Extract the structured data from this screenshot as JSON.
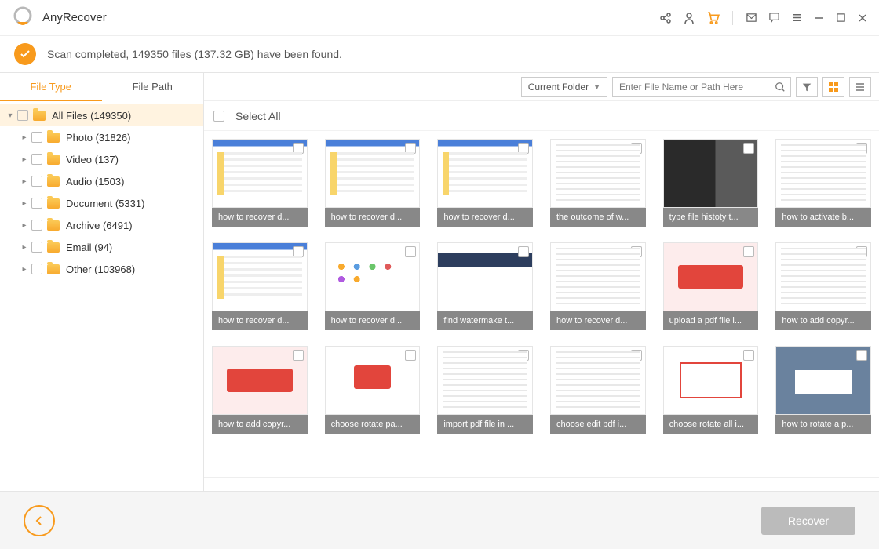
{
  "app": {
    "title": "AnyRecover"
  },
  "status": {
    "text": "Scan completed, 149350 files (137.32 GB) have been found."
  },
  "sidebar": {
    "tabs": [
      {
        "label": "File Type",
        "active": true
      },
      {
        "label": "File Path",
        "active": false
      }
    ],
    "root": {
      "label": "All Files (149350)"
    },
    "items": [
      {
        "label": "Photo (31826)"
      },
      {
        "label": "Video (137)"
      },
      {
        "label": "Audio (1503)"
      },
      {
        "label": "Document (5331)"
      },
      {
        "label": "Archive (6491)"
      },
      {
        "label": "Email (94)"
      },
      {
        "label": "Other (103968)"
      }
    ]
  },
  "toolbar": {
    "folder_dropdown": "Current Folder",
    "search_placeholder": "Enter File Name or Path Here"
  },
  "select_all": {
    "label": "Select All"
  },
  "thumbnails": [
    {
      "caption": "how to recover d...",
      "variant": "timg-win"
    },
    {
      "caption": "how to recover d...",
      "variant": "timg-win"
    },
    {
      "caption": "how to recover d...",
      "variant": "timg-win"
    },
    {
      "caption": "the outcome of w...",
      "variant": "timg-app"
    },
    {
      "caption": "type file histoty t...",
      "variant": "timg-dark"
    },
    {
      "caption": "how to activate b...",
      "variant": "timg-app"
    },
    {
      "caption": "how to recover d...",
      "variant": "timg-win"
    },
    {
      "caption": "how to recover d...",
      "variant": "timg-icons"
    },
    {
      "caption": "find watermake t...",
      "variant": "timg-wm"
    },
    {
      "caption": "how to recover d...",
      "variant": "timg-app"
    },
    {
      "caption": "upload a pdf file i...",
      "variant": "timg-red"
    },
    {
      "caption": "how to add copyr...",
      "variant": "timg-app"
    },
    {
      "caption": "how to add copyr...",
      "variant": "timg-red"
    },
    {
      "caption": "choose rotate pa...",
      "variant": "timg-pdf"
    },
    {
      "caption": "import pdf file in ...",
      "variant": "timg-app"
    },
    {
      "caption": "choose edit pdf i...",
      "variant": "timg-app"
    },
    {
      "caption": "choose rotate all i...",
      "variant": "timg-rotate"
    },
    {
      "caption": "how to rotate a p...",
      "variant": "timg-dialog"
    }
  ],
  "footer": {
    "recover_label": "Recover"
  }
}
